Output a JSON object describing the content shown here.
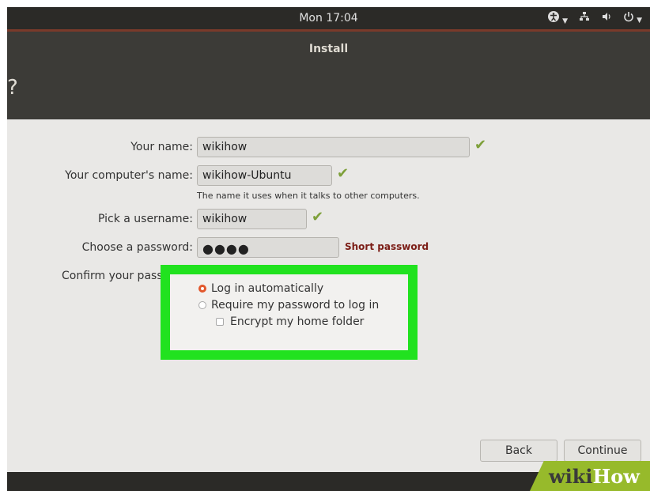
{
  "topbar": {
    "clock": "Mon 17:04",
    "icons": [
      "accessibility-icon",
      "network-icon",
      "volume-icon",
      "power-icon"
    ]
  },
  "window": {
    "title": "Install",
    "header_symbol": "?"
  },
  "form": {
    "your_name": {
      "label": "Your name:",
      "value": "wikihow"
    },
    "computer_name": {
      "label": "Your computer's name:",
      "value": "wikihow-Ubuntu",
      "hint": "The name it uses when it talks to other computers."
    },
    "username": {
      "label": "Pick a username:",
      "value": "wikihow"
    },
    "password": {
      "label": "Choose a password:",
      "value": "●●●●",
      "warning": "Short password"
    },
    "confirm": {
      "label": "Confirm your pass",
      "value": ""
    }
  },
  "login_options": {
    "auto": "Log in automatically",
    "require": "Require my password to log in",
    "encrypt": "Encrypt my home folder",
    "selected": "auto"
  },
  "buttons": {
    "back": "Back",
    "continue": "Continue"
  },
  "watermark": {
    "part1": "wiki",
    "part2": "How"
  },
  "colors": {
    "highlight": "#21e21f",
    "check": "#7ea03a",
    "warning": "#7b1d16",
    "radio_selected": "#e2572c"
  }
}
